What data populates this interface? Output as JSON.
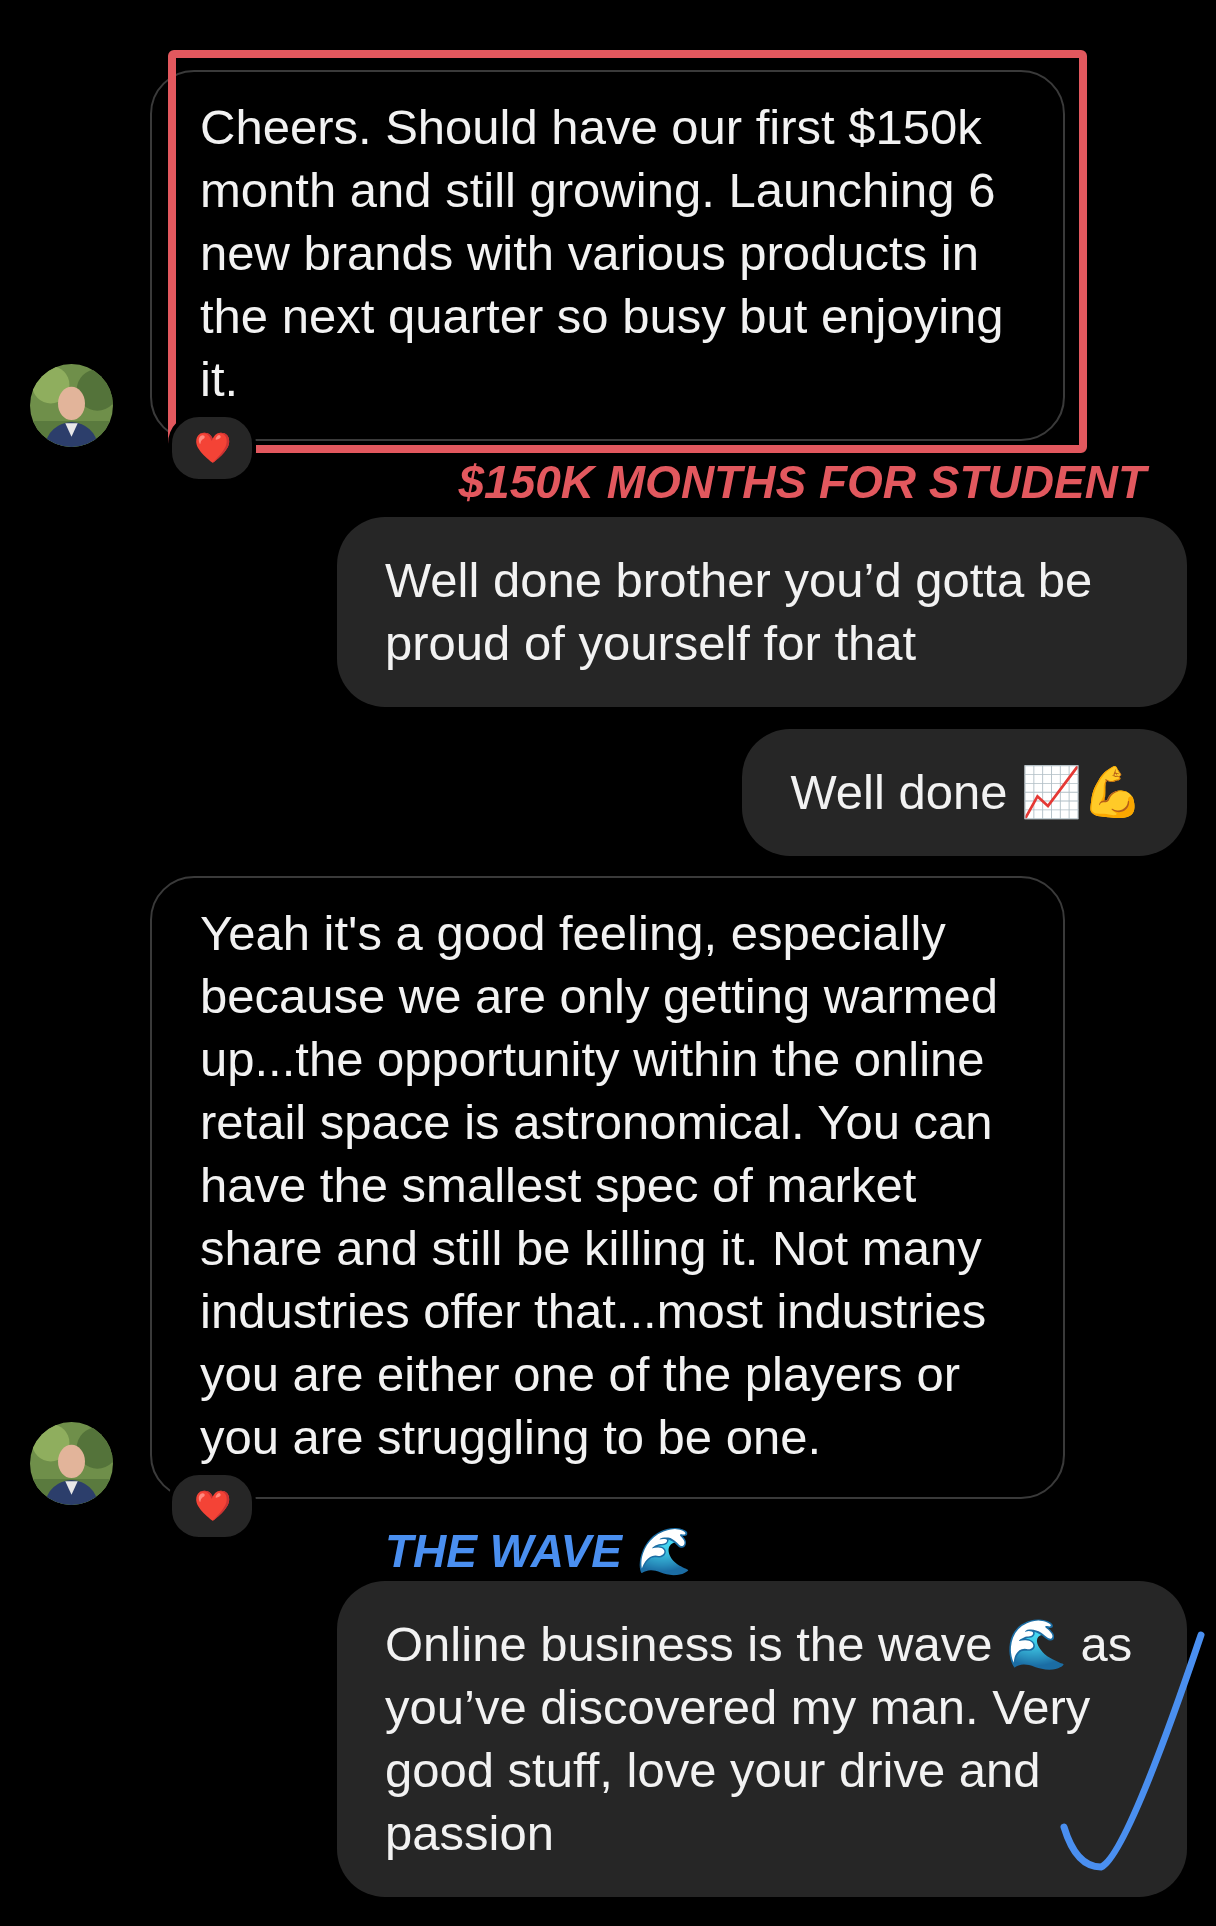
{
  "items": [
    {
      "kind": "received",
      "text": "Cheers. Should have our first $150k month and still growing. Launching 6 new brands with various products in the next quarter so busy but enjoying it.",
      "reaction": "❤️",
      "outlined": true,
      "checkmark": false
    },
    {
      "kind": "caption",
      "text": "$150K MONTHS FOR STUDENT",
      "color": "#e2585e"
    },
    {
      "kind": "sent",
      "text": "Well done brother you’d gotta be proud of yourself for that",
      "outlined": false,
      "checkmark": false
    },
    {
      "kind": "sent",
      "text": "Well done 📈💪",
      "outlined": false,
      "checkmark": false
    },
    {
      "kind": "received",
      "text": "Yeah it's a good feeling, especially because we are only getting warmed up...the opportunity within the online retail space is astronomical. You can have the smallest spec of market share and still be killing it. Not many industries offer that...most industries you are either one of the players or you are struggling to be one.",
      "reaction": "❤️",
      "outlined": false,
      "checkmark": false
    },
    {
      "kind": "caption",
      "text": "THE WAVE 🌊",
      "color": "#4a8ff0"
    },
    {
      "kind": "sent",
      "text": "Online business is the wave 🌊 as you’ve discovered my man. Very good stuff, love your drive and passion",
      "outlined": false,
      "checkmark": true
    }
  ]
}
